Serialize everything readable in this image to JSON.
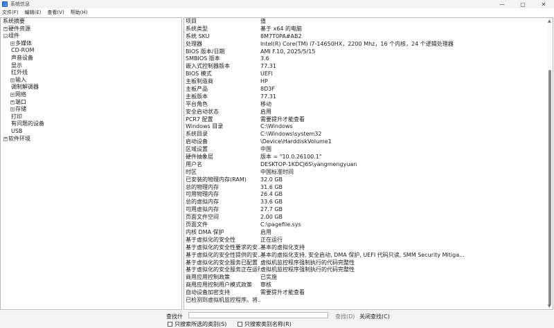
{
  "window": {
    "title": "系统信息",
    "minimize": "—",
    "maximize": "▢",
    "close": "✕"
  },
  "menu": [
    "文件(F)",
    "编辑(E)",
    "查看(V)",
    "帮助(H)"
  ],
  "tree": [
    {
      "label": "系统摘要",
      "level": 0,
      "expander": ""
    },
    {
      "label": "硬件资源",
      "level": 1,
      "expander": "+"
    },
    {
      "label": "组件",
      "level": 1,
      "expander": "−"
    },
    {
      "label": "多媒体",
      "level": 2,
      "expander": "+"
    },
    {
      "label": "CD-ROM",
      "level": 2,
      "expander": ""
    },
    {
      "label": "声音设备",
      "level": 2,
      "expander": ""
    },
    {
      "label": "显示",
      "level": 2,
      "expander": ""
    },
    {
      "label": "红外线",
      "level": 2,
      "expander": ""
    },
    {
      "label": "输入",
      "level": 2,
      "expander": "+"
    },
    {
      "label": "调制解调器",
      "level": 2,
      "expander": ""
    },
    {
      "label": "网络",
      "level": 2,
      "expander": "+"
    },
    {
      "label": "端口",
      "level": 2,
      "expander": "+"
    },
    {
      "label": "存储",
      "level": 2,
      "expander": "+"
    },
    {
      "label": "打印",
      "level": 2,
      "expander": ""
    },
    {
      "label": "有问题的设备",
      "level": 2,
      "expander": ""
    },
    {
      "label": "USB",
      "level": 2,
      "expander": ""
    },
    {
      "label": "软件环境",
      "level": 1,
      "expander": "+"
    }
  ],
  "details": {
    "header": [
      "项目",
      "值"
    ],
    "rows": [
      [
        "系统类型",
        "基于 x64 的电脑"
      ],
      [
        "系统 SKU",
        "8M7T0PA#AB2"
      ],
      [
        "处理器",
        "Intel(R) Core(TM) i7-14650HX，2200 Mhz，16 个内核，24 个逻辑处理器"
      ],
      [
        "BIOS 版本/日期",
        "AMI F.10, 2025/5/15"
      ],
      [
        "SMBIOS 版本",
        "3.6"
      ],
      [
        "嵌入式控制器版本",
        "77.31"
      ],
      [
        "BIOS 模式",
        "UEFI"
      ],
      [
        "主板制造商",
        "HP"
      ],
      [
        "主板产品",
        "8D3F"
      ],
      [
        "主板版本",
        "77.31"
      ],
      [
        "平台角色",
        "移动"
      ],
      [
        "安全启动状态",
        "启用"
      ],
      [
        "PCR7 配置",
        "需要提升才能查看"
      ],
      [
        "Windows 目录",
        "C:\\Windows"
      ],
      [
        "系统目录",
        "C:\\Windows\\system32"
      ],
      [
        "启动设备",
        "\\Device\\HarddiskVolume1"
      ],
      [
        "区域设置",
        "中国"
      ],
      [
        "硬件抽象层",
        "版本 = \"10.0.26100.1\""
      ],
      [
        "用户名",
        "DESKTOP-1KDCJ6S\\yangmengyuan"
      ],
      [
        "时区",
        "中国标准时间"
      ],
      [
        "已安装的物理内存(RAM)",
        "32.0 GB"
      ],
      [
        "总的物理内存",
        "31.6 GB"
      ],
      [
        "可用物理内存",
        "26.4 GB"
      ],
      [
        "总的虚拟内存",
        "33.6 GB"
      ],
      [
        "可用虚拟内存",
        "27.7 GB"
      ],
      [
        "页面文件空间",
        "2.00 GB"
      ],
      [
        "页面文件",
        "C:\\pagefile.sys"
      ],
      [
        "内核 DMA 保护",
        "启用"
      ],
      [
        "基于虚拟化的安全性",
        "正在运行"
      ],
      [
        "基于虚拟化的安全性要求的安...",
        "基本的虚拟化支持"
      ],
      [
        "基于虚拟化的安全性提供的安...",
        "基本的虚拟化支持, 安全启动, DMA 保护, UEFI 代码只读, SMM Security Mitiga..."
      ],
      [
        "基于虚拟化的安全服务已配置",
        "虚拟机监控程序强制执行的代码完整性"
      ],
      [
        "基于虚拟化的安全服务正在运行",
        "虚拟机监控程序强制执行的代码完整性"
      ],
      [
        "商用应用控制政策",
        "已实施"
      ],
      [
        "商用应用控制用户模式政策",
        "审核"
      ],
      [
        "自动设备加密支持",
        "需要提升才能查看"
      ],
      [
        "已检测到虚拟机监控程序。将...",
        ""
      ]
    ]
  },
  "find": {
    "label": "查找什",
    "find_button": "查找(D)",
    "close_button": "关闭查找(C)",
    "option1": "只搜索所选的类别(S)",
    "option2": "只搜索类别名称(R)"
  },
  "scroll": {
    "up": "▲",
    "down": "▼"
  }
}
